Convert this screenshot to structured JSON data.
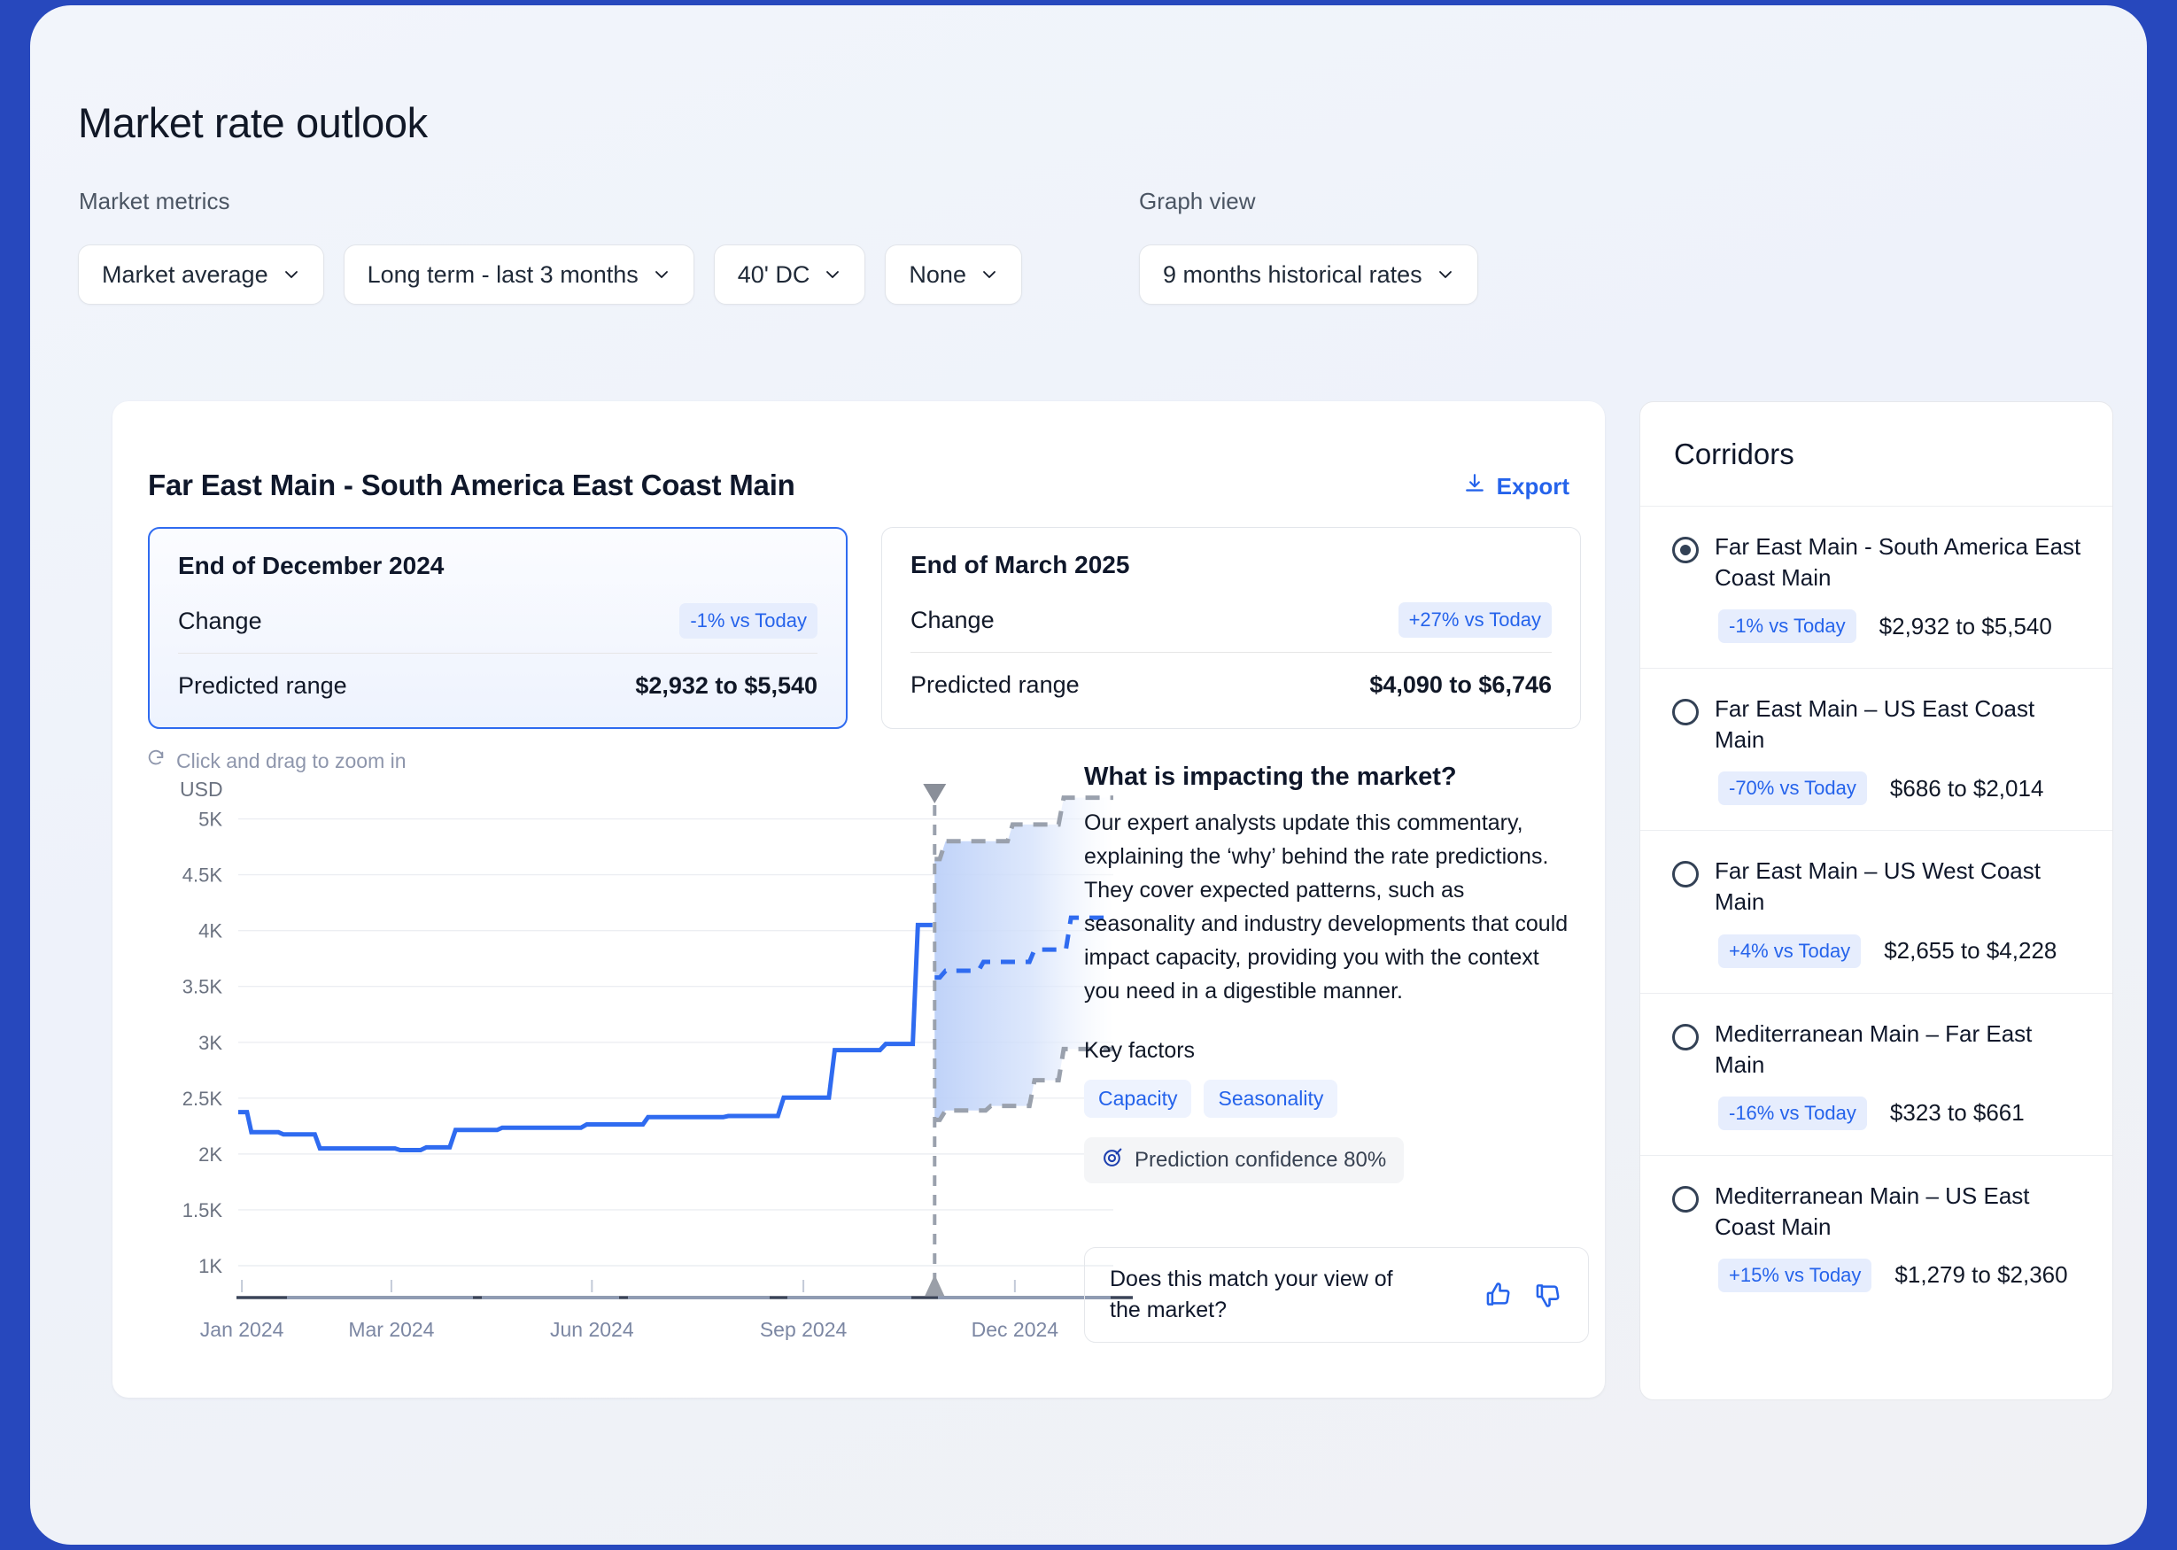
{
  "header": {
    "title": "Market rate outlook",
    "metrics_label": "Market metrics",
    "graph_view_label": "Graph view"
  },
  "filters": [
    {
      "value": "Market average"
    },
    {
      "value": "Long term - last 3 months"
    },
    {
      "value": "40' DC"
    },
    {
      "value": "None"
    }
  ],
  "graph_view": {
    "value": "9 months historical rates"
  },
  "main": {
    "title": "Far East Main - South America East Coast Main",
    "export_label": "Export",
    "zoom_hint": "Click and drag to zoom in",
    "summary": [
      {
        "heading": "End of December 2024",
        "change_label": "Change",
        "change_value": "-1%  vs Today",
        "range_label": "Predicted range",
        "range_value": "$2,932 to $5,540"
      },
      {
        "heading": "End of March 2025",
        "change_label": "Change",
        "change_value": "+27% vs Today",
        "range_label": "Predicted range",
        "range_value": "$4,090 to $6,746"
      }
    ],
    "commentary": {
      "title": "What is impacting the market?",
      "body": "Our expert analysts update this commentary, explaining the ‘why’ behind the rate predictions. They cover expected patterns, such as seasonality and industry developments that could impact capacity, providing you with the context you need in a digestible manner.",
      "key_factors_label": "Key factors",
      "tags": [
        "Capacity",
        "Seasonality"
      ],
      "confidence": "Prediction confidence 80%"
    },
    "feedback": {
      "question": "Does this match your view of the market?",
      "thumbs_up": "thumbs-up",
      "thumbs_down": "thumbs-down"
    }
  },
  "corridors": {
    "title": "Corridors",
    "items": [
      {
        "name": "Far East Main - South America East Coast Main",
        "change": "-1% vs Today",
        "range": "$2,932 to $5,540",
        "selected": true
      },
      {
        "name": "Far East Main – US East Coast Main",
        "change": "-70% vs Today",
        "range": "$686 to $2,014",
        "selected": false
      },
      {
        "name": "Far East Main – US West Coast Main",
        "change": "+4% vs Today",
        "range": "$2,655 to $4,228",
        "selected": false
      },
      {
        "name": "Mediterranean Main – Far East Main",
        "change": "-16% vs Today",
        "range": "$323 to $661",
        "selected": false
      },
      {
        "name": "Mediterranean Main – US East Coast Main",
        "change": "+15% vs Today",
        "range": "$1,279 to $2,360",
        "selected": false
      }
    ]
  },
  "colors": {
    "accent": "#2563eb",
    "line": "#2f6bf0",
    "band_stroke": "#9aa1ad",
    "chip_bg": "#e6edfd",
    "page_bg": "#eef2fa",
    "frame": "#2748bd"
  },
  "chart_data": {
    "type": "line",
    "title": "",
    "xlabel": "",
    "ylabel": "USD",
    "ylim": [
      1000,
      5250
    ],
    "yticks": [
      1000,
      1500,
      2000,
      2500,
      3000,
      3500,
      4000,
      4500,
      5000
    ],
    "ytick_labels": [
      "1K",
      "1.5K",
      "2K",
      "2.5K",
      "3K",
      "3.5K",
      "4K",
      "4.5K",
      "5K"
    ],
    "xticks": [
      0,
      2,
      5,
      8,
      11
    ],
    "xtick_labels": [
      "Jan 2024",
      "Mar 2024",
      "Jun 2024",
      "Sep 2024",
      "Dec 2024"
    ],
    "grid": true,
    "legend": "none",
    "today_marker_x": 9.55,
    "series": [
      {
        "name": "Historical rate",
        "style": "solid",
        "color": "#2f6bf0",
        "x": [
          0.0,
          0.12,
          0.18,
          0.55,
          0.62,
          1.05,
          1.12,
          2.15,
          2.22,
          2.5,
          2.58,
          2.9,
          2.98,
          3.55,
          3.62,
          4.7,
          4.78,
          5.55,
          5.62,
          6.65,
          6.72,
          7.4,
          7.48,
          8.1,
          8.18,
          8.8,
          8.88,
          9.25,
          9.32,
          9.52
        ],
        "y": [
          2375,
          2375,
          2195,
          2195,
          2175,
          2175,
          2050,
          2050,
          2035,
          2035,
          2060,
          2060,
          2215,
          2215,
          2235,
          2235,
          2265,
          2265,
          2330,
          2330,
          2340,
          2340,
          2505,
          2505,
          2930,
          2930,
          2985,
          2985,
          4050,
          4050
        ]
      },
      {
        "name": "Predicted rate (median)",
        "style": "dashed",
        "color": "#2f6bf0",
        "x": [
          9.55,
          9.62,
          9.7,
          10.15,
          10.22,
          10.85,
          10.92,
          11.35,
          11.42,
          12.0
        ],
        "y": [
          3580,
          3580,
          3640,
          3640,
          3720,
          3720,
          3830,
          3830,
          4115,
          4115
        ]
      },
      {
        "name": "Prediction upper bound",
        "style": "dashed",
        "color": "#9aa1ad",
        "x": [
          9.55,
          9.62,
          9.7,
          10.55,
          10.62,
          11.25,
          11.32,
          12.0
        ],
        "y": [
          4640,
          4640,
          4800,
          4800,
          4950,
          4950,
          5190,
          5190
        ]
      },
      {
        "name": "Prediction lower bound",
        "style": "dashed",
        "color": "#9aa1ad",
        "x": [
          9.55,
          9.62,
          9.7,
          10.25,
          10.32,
          10.85,
          10.92,
          11.25,
          11.32,
          12.0
        ],
        "y": [
          2305,
          2305,
          2390,
          2390,
          2430,
          2430,
          2660,
          2660,
          2940,
          2940
        ]
      }
    ]
  }
}
